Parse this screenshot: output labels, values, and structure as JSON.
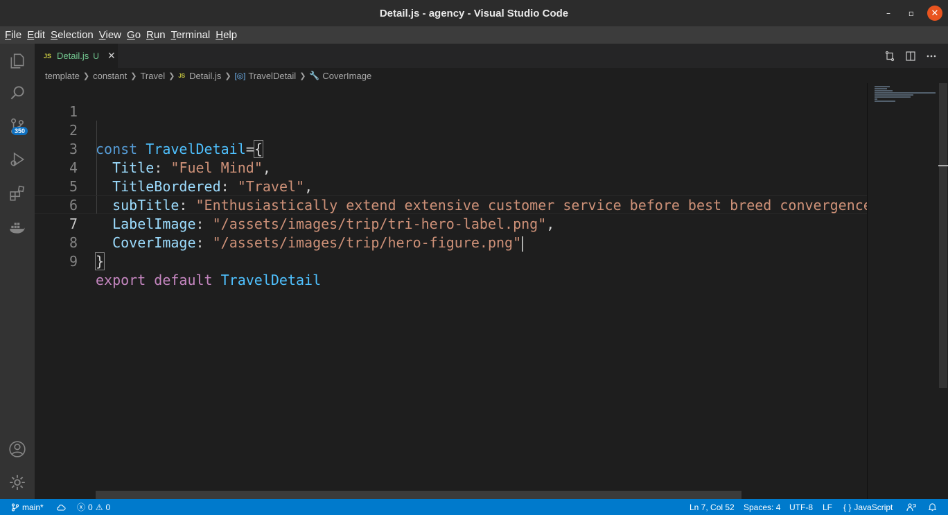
{
  "window": {
    "title": "Detail.js - agency - Visual Studio Code",
    "minimize_glyph": "–",
    "maximize_glyph": "▫",
    "close_glyph": "✕"
  },
  "menu": {
    "items": [
      {
        "label": "File",
        "mnemonic": "F",
        "rest": "ile"
      },
      {
        "label": "Edit",
        "mnemonic": "E",
        "rest": "dit"
      },
      {
        "label": "Selection",
        "mnemonic": "S",
        "rest": "election"
      },
      {
        "label": "View",
        "mnemonic": "V",
        "rest": "iew"
      },
      {
        "label": "Go",
        "mnemonic": "G",
        "rest": "o"
      },
      {
        "label": "Run",
        "mnemonic": "R",
        "rest": "un"
      },
      {
        "label": "Terminal",
        "mnemonic": "T",
        "rest": "erminal"
      },
      {
        "label": "Help",
        "mnemonic": "H",
        "rest": "elp"
      }
    ]
  },
  "activity_bar": {
    "source_control_badge": "350",
    "icons": [
      "explorer-icon",
      "search-icon",
      "source-control-icon",
      "run-debug-icon",
      "extensions-icon",
      "docker-icon",
      "account-icon",
      "settings-gear-icon"
    ]
  },
  "tab": {
    "file_icon": "JS",
    "filename": "Detail.js",
    "status": "U",
    "close_glyph": "✕"
  },
  "breadcrumbs": {
    "items": [
      "template",
      "constant",
      "Travel",
      "Detail.js",
      "TravelDetail",
      "CoverImage"
    ],
    "file_icon": "JS",
    "symbol_icon": "[◎]",
    "property_icon": "🔧"
  },
  "editor": {
    "line_numbers": [
      "1",
      "2",
      "3",
      "4",
      "5",
      "6",
      "7",
      "8",
      "9"
    ],
    "current_line": 7,
    "tokens": {
      "l2_const": "const",
      "l2_name": "TravelDetail",
      "l2_eq": "=",
      "l2_brace": "{",
      "l3_key": "Title",
      "l3_colon": ": ",
      "l3_val": "\"Fuel Mind\"",
      "l3_comma": ",",
      "l4_key": "TitleBordered",
      "l4_colon": ": ",
      "l4_val": "\"Travel\"",
      "l4_comma": ",",
      "l5_key": "subTitle",
      "l5_colon": ": ",
      "l5_val": "\"Enthusiastically extend extensive customer service before best breed convergence",
      "l6_key": "LabelImage",
      "l6_colon": ": ",
      "l6_val": "\"/assets/images/trip/tri-hero-label.png\"",
      "l6_comma": ",",
      "l7_key": "CoverImage",
      "l7_colon": ": ",
      "l7_val": "\"/assets/images/trip/hero-figure.png\"",
      "l8_brace": "}",
      "l9_export": "export",
      "l9_default": "default",
      "l9_name": "TravelDetail"
    }
  },
  "status_bar": {
    "branch": "main*",
    "errors": "0",
    "warnings": "0",
    "cursor_position": "Ln 7, Col 52",
    "indentation": "Spaces: 4",
    "encoding": "UTF-8",
    "eol": "LF",
    "language": "JavaScript",
    "language_icon": "{ }"
  },
  "colors": {
    "status_bar": "#007acc",
    "keyword": "#569cd6",
    "control_keyword": "#c586c0",
    "identifier": "#4fc1ff",
    "property": "#9cdcfe",
    "string": "#ce9178",
    "untracked_file": "#73c991",
    "close_button": "#e9541f"
  }
}
